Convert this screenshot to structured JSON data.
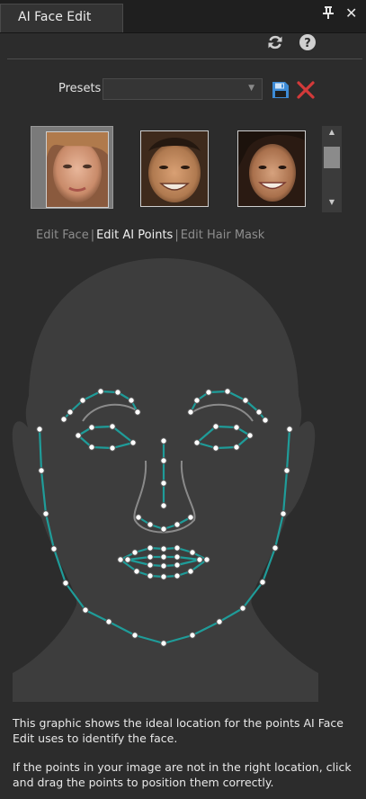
{
  "panel": {
    "title": "AI Face Edit",
    "pin_glyph": "⊥",
    "close_glyph": "✕"
  },
  "toolbar": {
    "refresh_icon": "refresh-icon",
    "help_icon": "help-icon"
  },
  "presets": {
    "label": "Presets",
    "selected_value": "",
    "save_icon": "save-icon",
    "delete_icon": "delete-icon"
  },
  "thumbnails": [
    {
      "name": "face-1",
      "selected": true
    },
    {
      "name": "face-2",
      "selected": false
    },
    {
      "name": "face-3",
      "selected": false
    }
  ],
  "modes": {
    "edit_face": "Edit Face",
    "edit_ai_points": "Edit AI Points",
    "edit_hair_mask": "Edit Hair Mask",
    "separator": "|",
    "active": "Edit AI Points"
  },
  "info": {
    "line1": "This graphic shows the ideal location for the points AI Face Edit uses to identify the face.",
    "line2": "If the points in your image are not in the right location, click and drag the points to position them correctly."
  },
  "colors": {
    "accent_teal": "#1f9c99",
    "save_blue": "#3d8bd6",
    "delete_red": "#d33a3a",
    "face_fill": "#3d3d3d"
  }
}
